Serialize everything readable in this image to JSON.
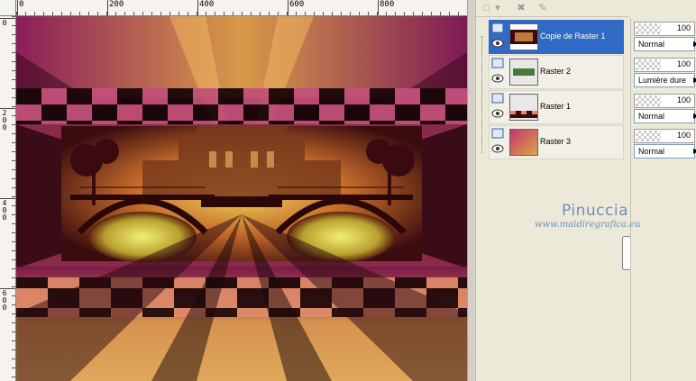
{
  "rulers": {
    "top_labels": [
      "0",
      "200",
      "400",
      "600",
      "800"
    ],
    "left_labels": [
      "0",
      "200",
      "400",
      "600"
    ]
  },
  "layers": [
    {
      "name": "Copie de Raster 1",
      "selected": true,
      "opacity": "100",
      "blend": "Normal"
    },
    {
      "name": "Raster 2",
      "selected": false,
      "opacity": "100",
      "blend": "Lumière dure"
    },
    {
      "name": "Raster 1",
      "selected": false,
      "opacity": "100",
      "blend": "Normal"
    },
    {
      "name": "Raster 3",
      "selected": false,
      "opacity": "100",
      "blend": "Normal"
    }
  ],
  "watermark": {
    "title": "Pinuccia",
    "url": "www.maidiregrafica.eu"
  },
  "colors": {
    "selection": "#316ac5",
    "panel_bg": "#ece9d8",
    "watermark": "#6d8fbf"
  },
  "icons": {
    "toolbar": [
      "new-layer-icon",
      "dropdown-arrow-icon",
      "delete-layer-icon",
      "mask-icon"
    ],
    "layer_row": [
      "layer-visibility-icon",
      "eye-icon"
    ]
  }
}
